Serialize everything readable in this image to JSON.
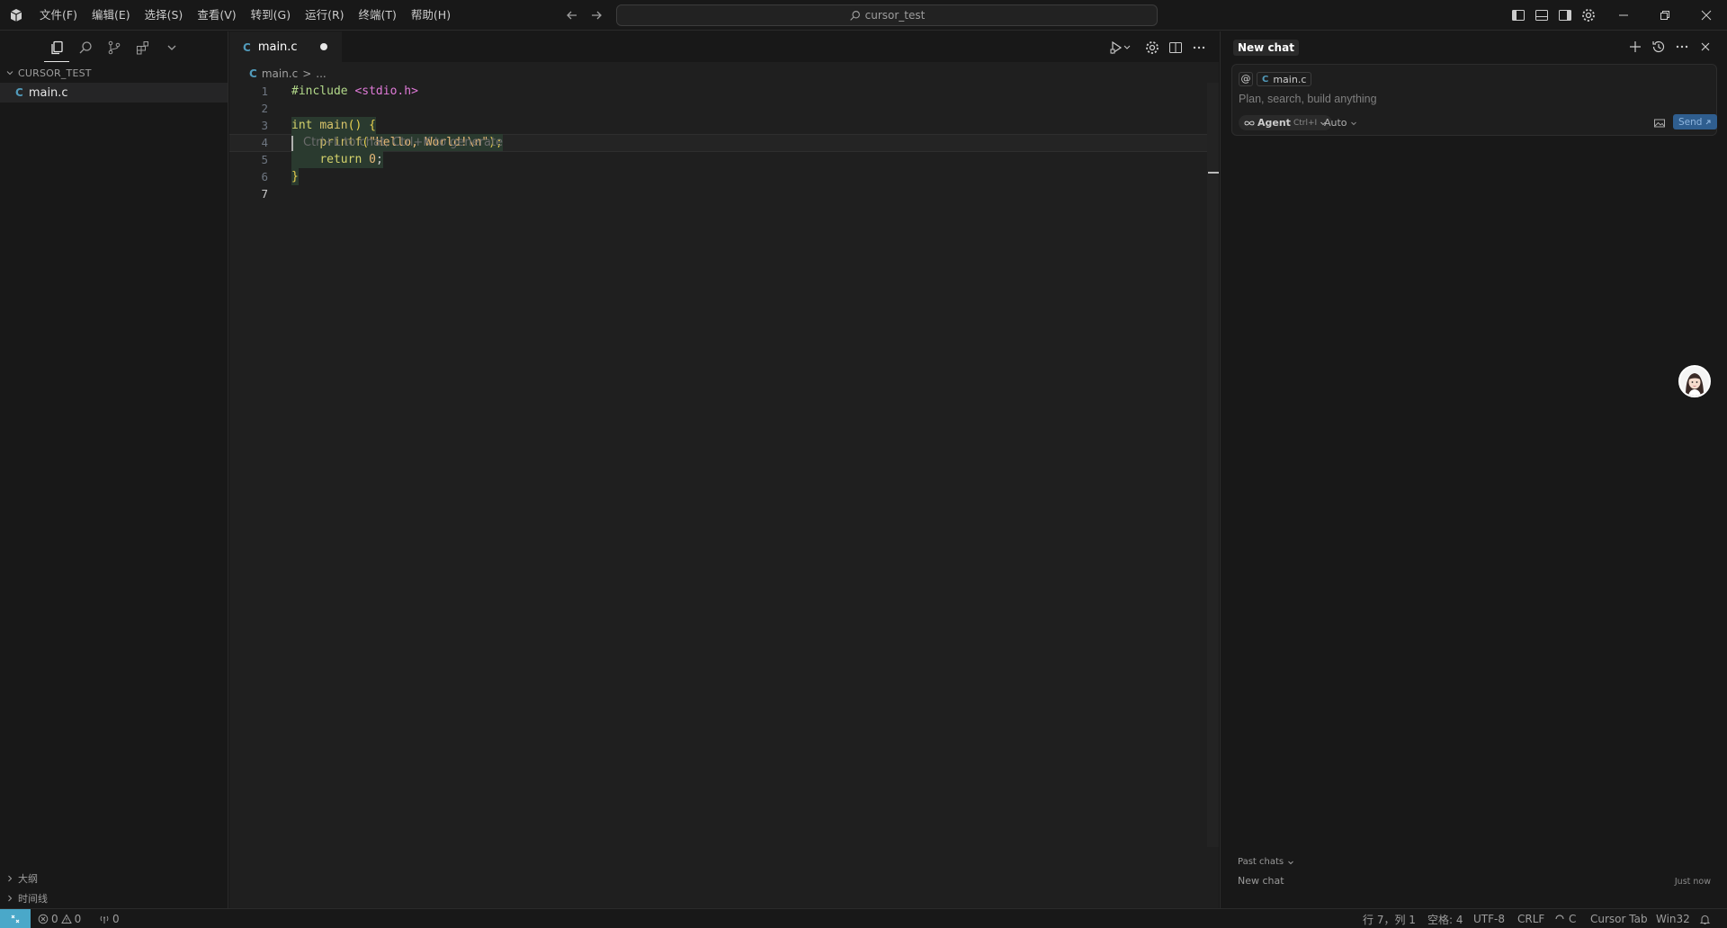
{
  "menu": {
    "items": [
      "文件(F)",
      "编辑(E)",
      "选择(S)",
      "查看(V)",
      "转到(G)",
      "运行(R)",
      "终端(T)",
      "帮助(H)"
    ]
  },
  "search": {
    "text": "cursor_test"
  },
  "sidebar": {
    "explorer_title": "CURSOR_TEST",
    "file_icon": "C",
    "file_name": "main.c",
    "outline_label": "大纲",
    "timeline_label": "时间线"
  },
  "editor": {
    "tab_icon": "C",
    "tab_label": "main.c",
    "breadcrumb_icon": "C",
    "breadcrumb_file": "main.c",
    "breadcrumb_sep": ">",
    "breadcrumb_rest": "...",
    "line_numbers": [
      "1",
      "2",
      "3",
      "4",
      "5",
      "6",
      "7"
    ],
    "code": {
      "l1_directive": "#include",
      "l1_header": "<stdio.h>",
      "l3_type": "int",
      "l3_name": "main",
      "l3_parens": "()",
      "l3_brace": "{",
      "l4_indent": "    ",
      "l4_fn": "printf",
      "l4_open": "(",
      "l4_str": "\"Hello, World!\\n\"",
      "l4_close": ");",
      "l5_indent": "    ",
      "l5_kw": "return",
      "l5_num": "0",
      "l5_semi": ";",
      "l6_brace": "}"
    },
    "ghost_hint": "Ctrl+L to chat, Ctrl+K to generate"
  },
  "chat": {
    "title": "New chat",
    "at_symbol": "@",
    "context_icon": "C",
    "context_file": "main.c",
    "placeholder": "Plan, search, build anything",
    "agent_label": "Agent",
    "agent_shortcut": "Ctrl+I",
    "model_label": "Auto",
    "send_label": "Send",
    "past_chats_label": "Past chats",
    "past_chat_title": "New chat",
    "past_chat_time": "Just now"
  },
  "status": {
    "errors": "0",
    "warnings": "0",
    "ports": "0",
    "position": "行 7，列 1",
    "spaces": "空格: 4",
    "encoding": "UTF-8",
    "eol": "CRLF",
    "language": "C",
    "cursor_tab": "Cursor Tab",
    "platform": "Win32"
  },
  "colors": {
    "accent": "#4aa8c9",
    "c_icon": "#519aba",
    "send_button": "#2f5e8f"
  },
  "icons": {
    "app": "cursor-logo-icon",
    "back": "arrow-left-icon",
    "forward": "arrow-right-icon",
    "search": "search-icon",
    "layout": [
      "toggle-primary-sidebar-icon",
      "toggle-panel-icon",
      "toggle-secondary-sidebar-icon",
      "gear-icon"
    ],
    "window": [
      "minimize-icon",
      "restore-icon",
      "close-icon"
    ],
    "sidebar_tools": [
      "explorer-icon",
      "search-icon",
      "source-control-icon",
      "extensions-icon",
      "chevron-down-icon"
    ],
    "editor_actions": [
      "run-debug-icon",
      "gear-icon",
      "split-editor-icon",
      "more-icon"
    ],
    "chat_actions": [
      "plus-icon",
      "history-icon",
      "more-icon",
      "close-icon"
    ]
  }
}
